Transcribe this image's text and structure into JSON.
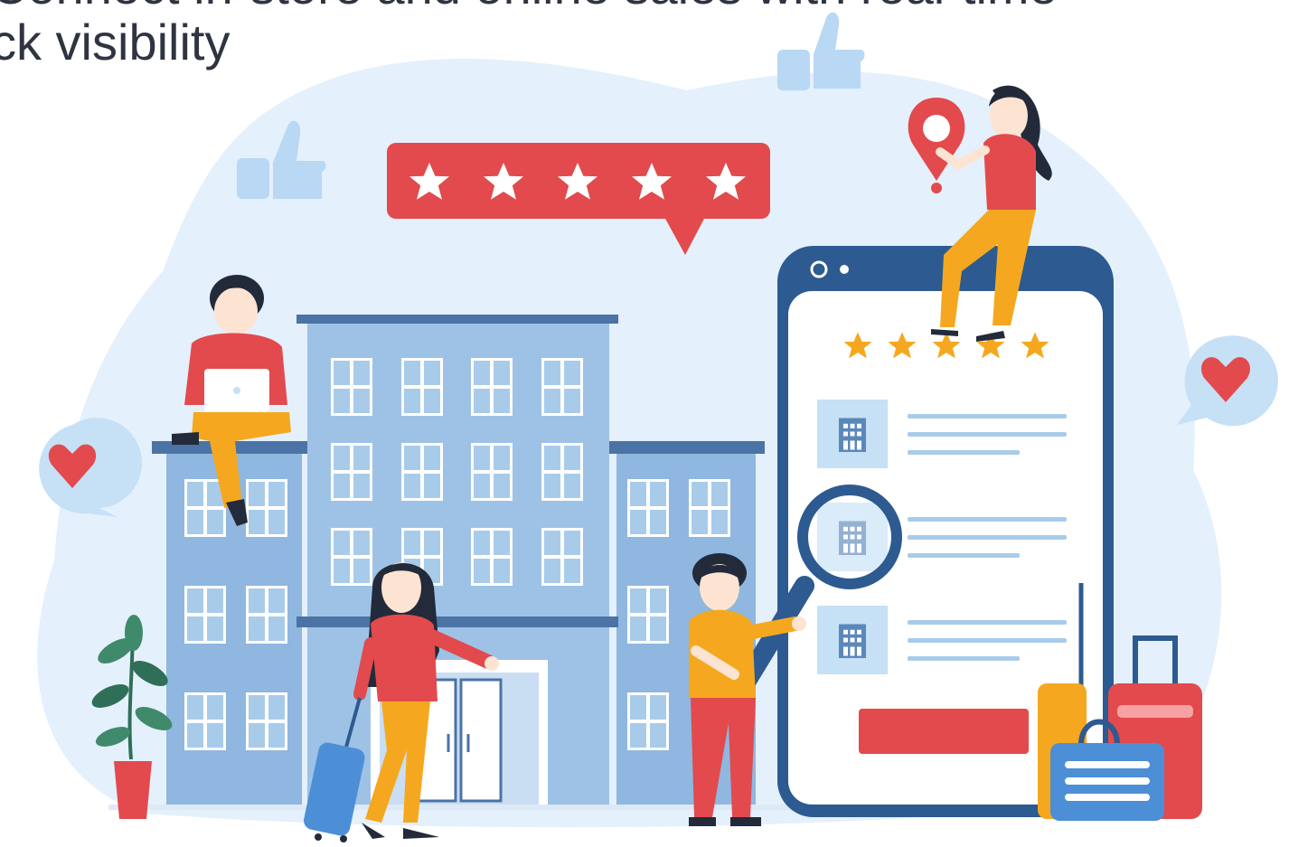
{
  "headline": {
    "line1": "Connect in-store and online sales with real-time",
    "line2": "ck visibility"
  },
  "illustration": {
    "rating_bubble_stars": 5,
    "phone_rating_stars": 5,
    "phone_listings": 3,
    "icons": [
      "thumbs-up-icon",
      "heart-icon",
      "map-pin-icon",
      "star-icon",
      "magnifier-icon",
      "suitcase-icon",
      "building-icon",
      "laptop-icon",
      "potted-plant-icon"
    ]
  },
  "colors": {
    "background_blob": "#e4f0fb",
    "building": "#8fb7df",
    "building_dark": "#4b73a5",
    "accent_red": "#e24a4d",
    "accent_yellow": "#f5a81f",
    "navy": "#2d5a90",
    "skin": "#fde4d2",
    "hair": "#232a3a"
  }
}
